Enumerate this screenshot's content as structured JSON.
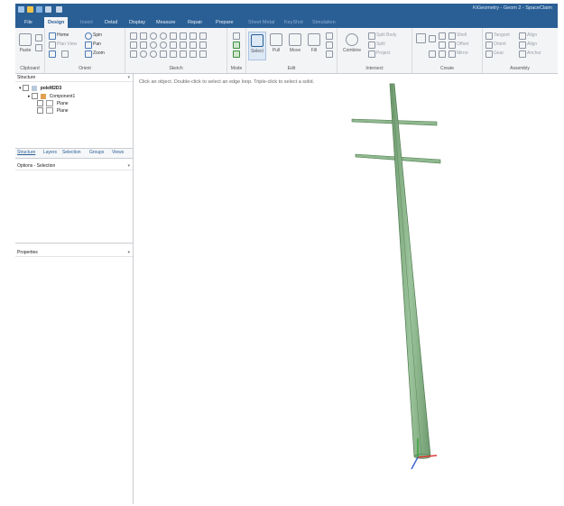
{
  "app": {
    "title": "KiGeometry - Geom 2 - SpaceClaim"
  },
  "tabs": [
    {
      "label": "File",
      "state": "normal"
    },
    {
      "label": "Design",
      "state": "active"
    },
    {
      "label": "Insert",
      "state": "dim"
    },
    {
      "label": "Detail",
      "state": "normal"
    },
    {
      "label": "Display",
      "state": "normal"
    },
    {
      "label": "Measure",
      "state": "normal"
    },
    {
      "label": "Repair",
      "state": "normal"
    },
    {
      "label": "Prepare",
      "state": "normal"
    },
    {
      "label": "Sheet Metal",
      "state": "dim"
    },
    {
      "label": "KeyShot",
      "state": "dim"
    },
    {
      "label": "Simulation",
      "state": "dim"
    }
  ],
  "ribbon": {
    "clipboard": {
      "label": "Clipboard",
      "paste": "Paste"
    },
    "orient": {
      "label": "Orient",
      "home": "Home",
      "spin": "Spin",
      "plan_view": "Plan View",
      "pan": "Pan",
      "zoom": "Zoom"
    },
    "sketch": {
      "label": "Sketch"
    },
    "mode": {
      "label": "Mode",
      "select": "Select"
    },
    "edit": {
      "label": "Edit",
      "pull": "Pull",
      "move": "Move",
      "fill": "Fill"
    },
    "intersect": {
      "label": "Intersect",
      "combine": "Combine",
      "split_body": "Split Body",
      "split": "Split",
      "project": "Project"
    },
    "create": {
      "label": "Create",
      "shell": "Shell",
      "offset": "Offset",
      "mirror": "Mirror"
    },
    "assembly": {
      "label": "Assembly",
      "tangent": "Tangent",
      "align": "Align",
      "orient": "Orient",
      "align2": "Align",
      "gear": "Gear",
      "anchor": "Anchor"
    }
  },
  "structure": {
    "title": "Structure",
    "tree": [
      {
        "label": "poleM2D3",
        "level": 0
      },
      {
        "label": "Component1",
        "level": 1
      },
      {
        "label": "Plane",
        "level": 2
      },
      {
        "label": "Plane",
        "level": 2
      }
    ]
  },
  "subtabs": [
    "Structure",
    "Layers",
    "Selection",
    "Groups",
    "Views"
  ],
  "options_panel": {
    "title": "Options - Selection"
  },
  "properties_panel": {
    "title": "Properties"
  },
  "viewport": {
    "hint": "Click an object. Double-click to select an edge loop. Triple-click to select a solid.",
    "model": "utility-pole",
    "pole_color": "#8fb88f"
  }
}
